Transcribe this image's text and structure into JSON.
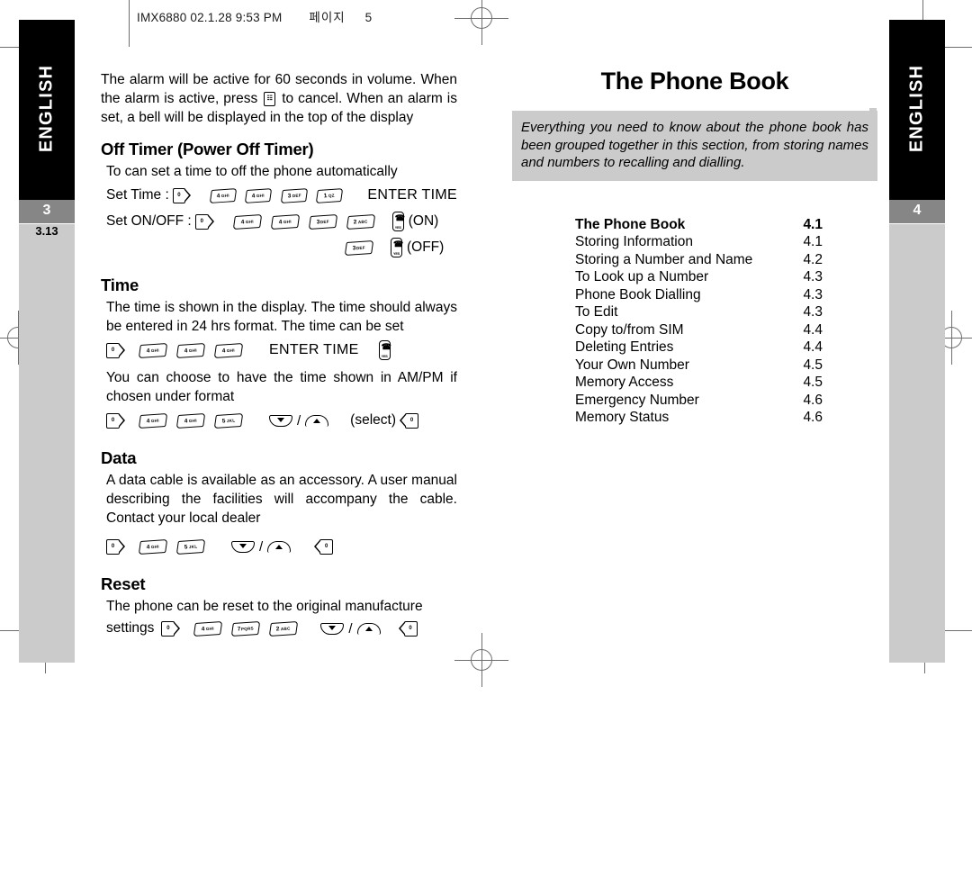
{
  "print_header": {
    "file": "IMX6880  02.1.28 9:53 PM",
    "page_label": "페이지",
    "page_number": "5"
  },
  "left_page": {
    "tab_label": "ENGLISH",
    "page_number": "3",
    "section_number": "3.13",
    "alarm_paragraph_1": "The alarm will be active for 60 seconds in volume. When the alarm is active, press",
    "alarm_paragraph_2": "to cancel.  When an alarm is set, a bell will be displayed in the top of the display",
    "sections": [
      {
        "heading": "Off Timer (Power Off Timer)",
        "body": "To can set a time to off the phone automatically"
      },
      {
        "heading": "Time",
        "body": "The time is shown in the display. The time should always be entered in 24 hrs format. The time can be set",
        "body2": "You can choose to have the time shown in AM/PM if chosen under format"
      },
      {
        "heading": "Data",
        "body": "A data cable is available as an accessory. A user manual describing the facilities will accompany the cable. Contact your local dealer"
      },
      {
        "heading": "Reset",
        "body": "The phone can be reset to the original manufacture",
        "body_tail": "settings"
      }
    ],
    "key_labels": {
      "set_time": "Set Time :",
      "set_onoff": "Set ON/OFF :",
      "enter_time": "ENTER TIME",
      "on": "(ON)",
      "off": "(OFF)",
      "select": "(select)",
      "slash": "/"
    },
    "keys": {
      "menu": "menu-key",
      "select": "select-key",
      "call": "call-key",
      "cancel": "cancel-key",
      "arrow_down": "nav-down-key",
      "arrow_up": "nav-up-key",
      "num1": {
        "digit": "1",
        "letters": "QZ"
      },
      "num2": {
        "digit": "2",
        "letters": "ABC"
      },
      "num3": {
        "digit": "3",
        "letters": "DEF"
      },
      "num4": {
        "digit": "4",
        "letters": "GHI"
      },
      "num5": {
        "digit": "5",
        "letters": "JKL"
      },
      "num7": {
        "digit": "7",
        "letters": "PQRS"
      }
    }
  },
  "right_page": {
    "tab_label": "ENGLISH",
    "page_number": "4",
    "title": "The Phone Book",
    "intro": "Everything you need to know about the phone book has been grouped together in this section, from storing names and numbers to recalling and dialling.",
    "toc": [
      {
        "label": "The Phone Book",
        "page": "4.1",
        "bold": true
      },
      {
        "label": "Storing Information",
        "page": "4.1"
      },
      {
        "label": "Storing a Number and Name",
        "page": "4.2"
      },
      {
        "label": "To Look up a Number",
        "page": "4.3"
      },
      {
        "label": "Phone Book Dialling",
        "page": "4.3"
      },
      {
        "label": "To Edit",
        "page": "4.3"
      },
      {
        "label": "Copy to/from SIM",
        "page": "4.4"
      },
      {
        "label": "Deleting Entries",
        "page": "4.4"
      },
      {
        "label": "Your Own Number",
        "page": "4.5"
      },
      {
        "label": "Memory Access",
        "page": "4.5"
      },
      {
        "label": "Emergency Number",
        "page": "4.6"
      },
      {
        "label": "Memory Status",
        "page": "4.6"
      }
    ]
  },
  "colors": {
    "tab_black": "#000000",
    "page_band_gray": "#868686",
    "panel_gray": "#cbcbcb",
    "regmark_gray": "#6e6e6e"
  }
}
